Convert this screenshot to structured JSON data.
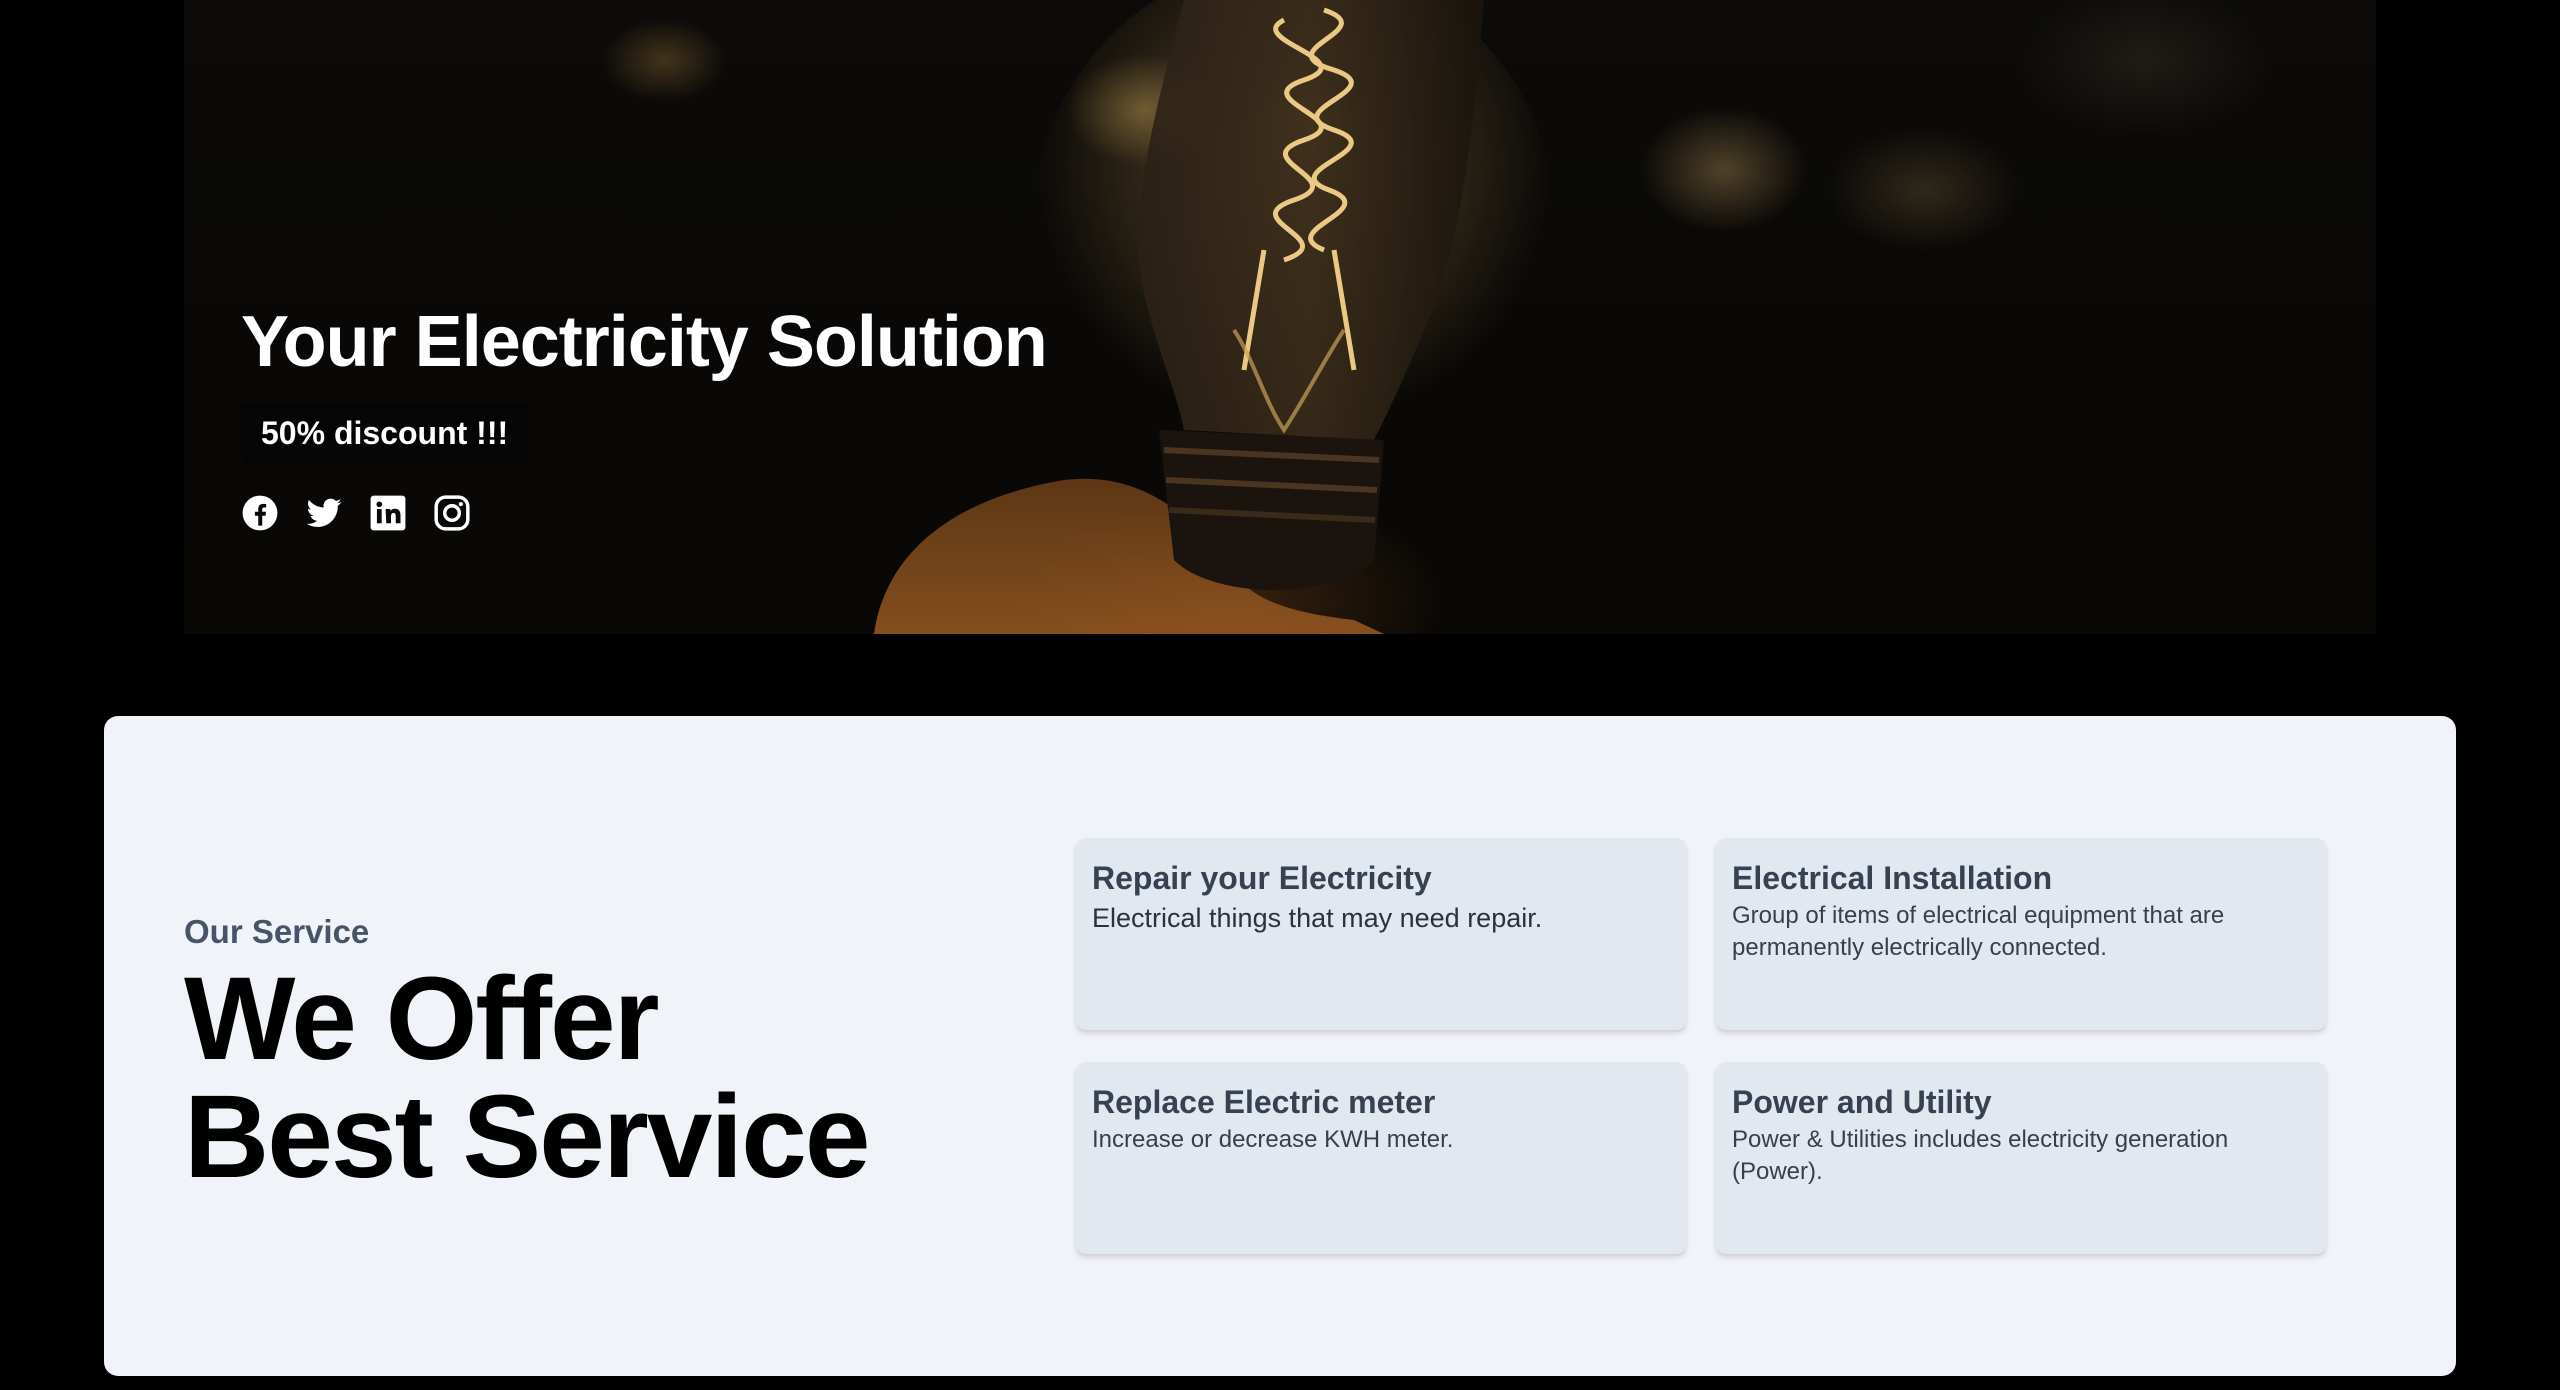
{
  "hero": {
    "title": "Your Electricity Solution",
    "badge": "50% discount !!!",
    "social": [
      {
        "icon": "facebook-icon"
      },
      {
        "icon": "twitter-icon"
      },
      {
        "icon": "linkedin-icon"
      },
      {
        "icon": "instagram-icon"
      }
    ]
  },
  "services": {
    "eyebrow": "Our Service",
    "heading_line1": "We Offer",
    "heading_line2": "Best Service",
    "cards": [
      {
        "title": "Repair your Electricity",
        "description": "Electrical things that may need repair."
      },
      {
        "title": "Electrical Installation",
        "description": "Group of items of electrical equipment that are permanently electrically connected."
      },
      {
        "title": "Replace Electric meter",
        "description": "Increase or decrease KWH meter."
      },
      {
        "title": "Power and Utility",
        "description": "Power & Utilities includes electricity generation (Power)."
      }
    ]
  },
  "colors": {
    "page_background": "#000000",
    "section_background": "#f0f3f8",
    "card_background": "#e2e8f0",
    "heading_text": "#000000",
    "muted_text": "#475467",
    "hero_text": "#ffffff"
  }
}
